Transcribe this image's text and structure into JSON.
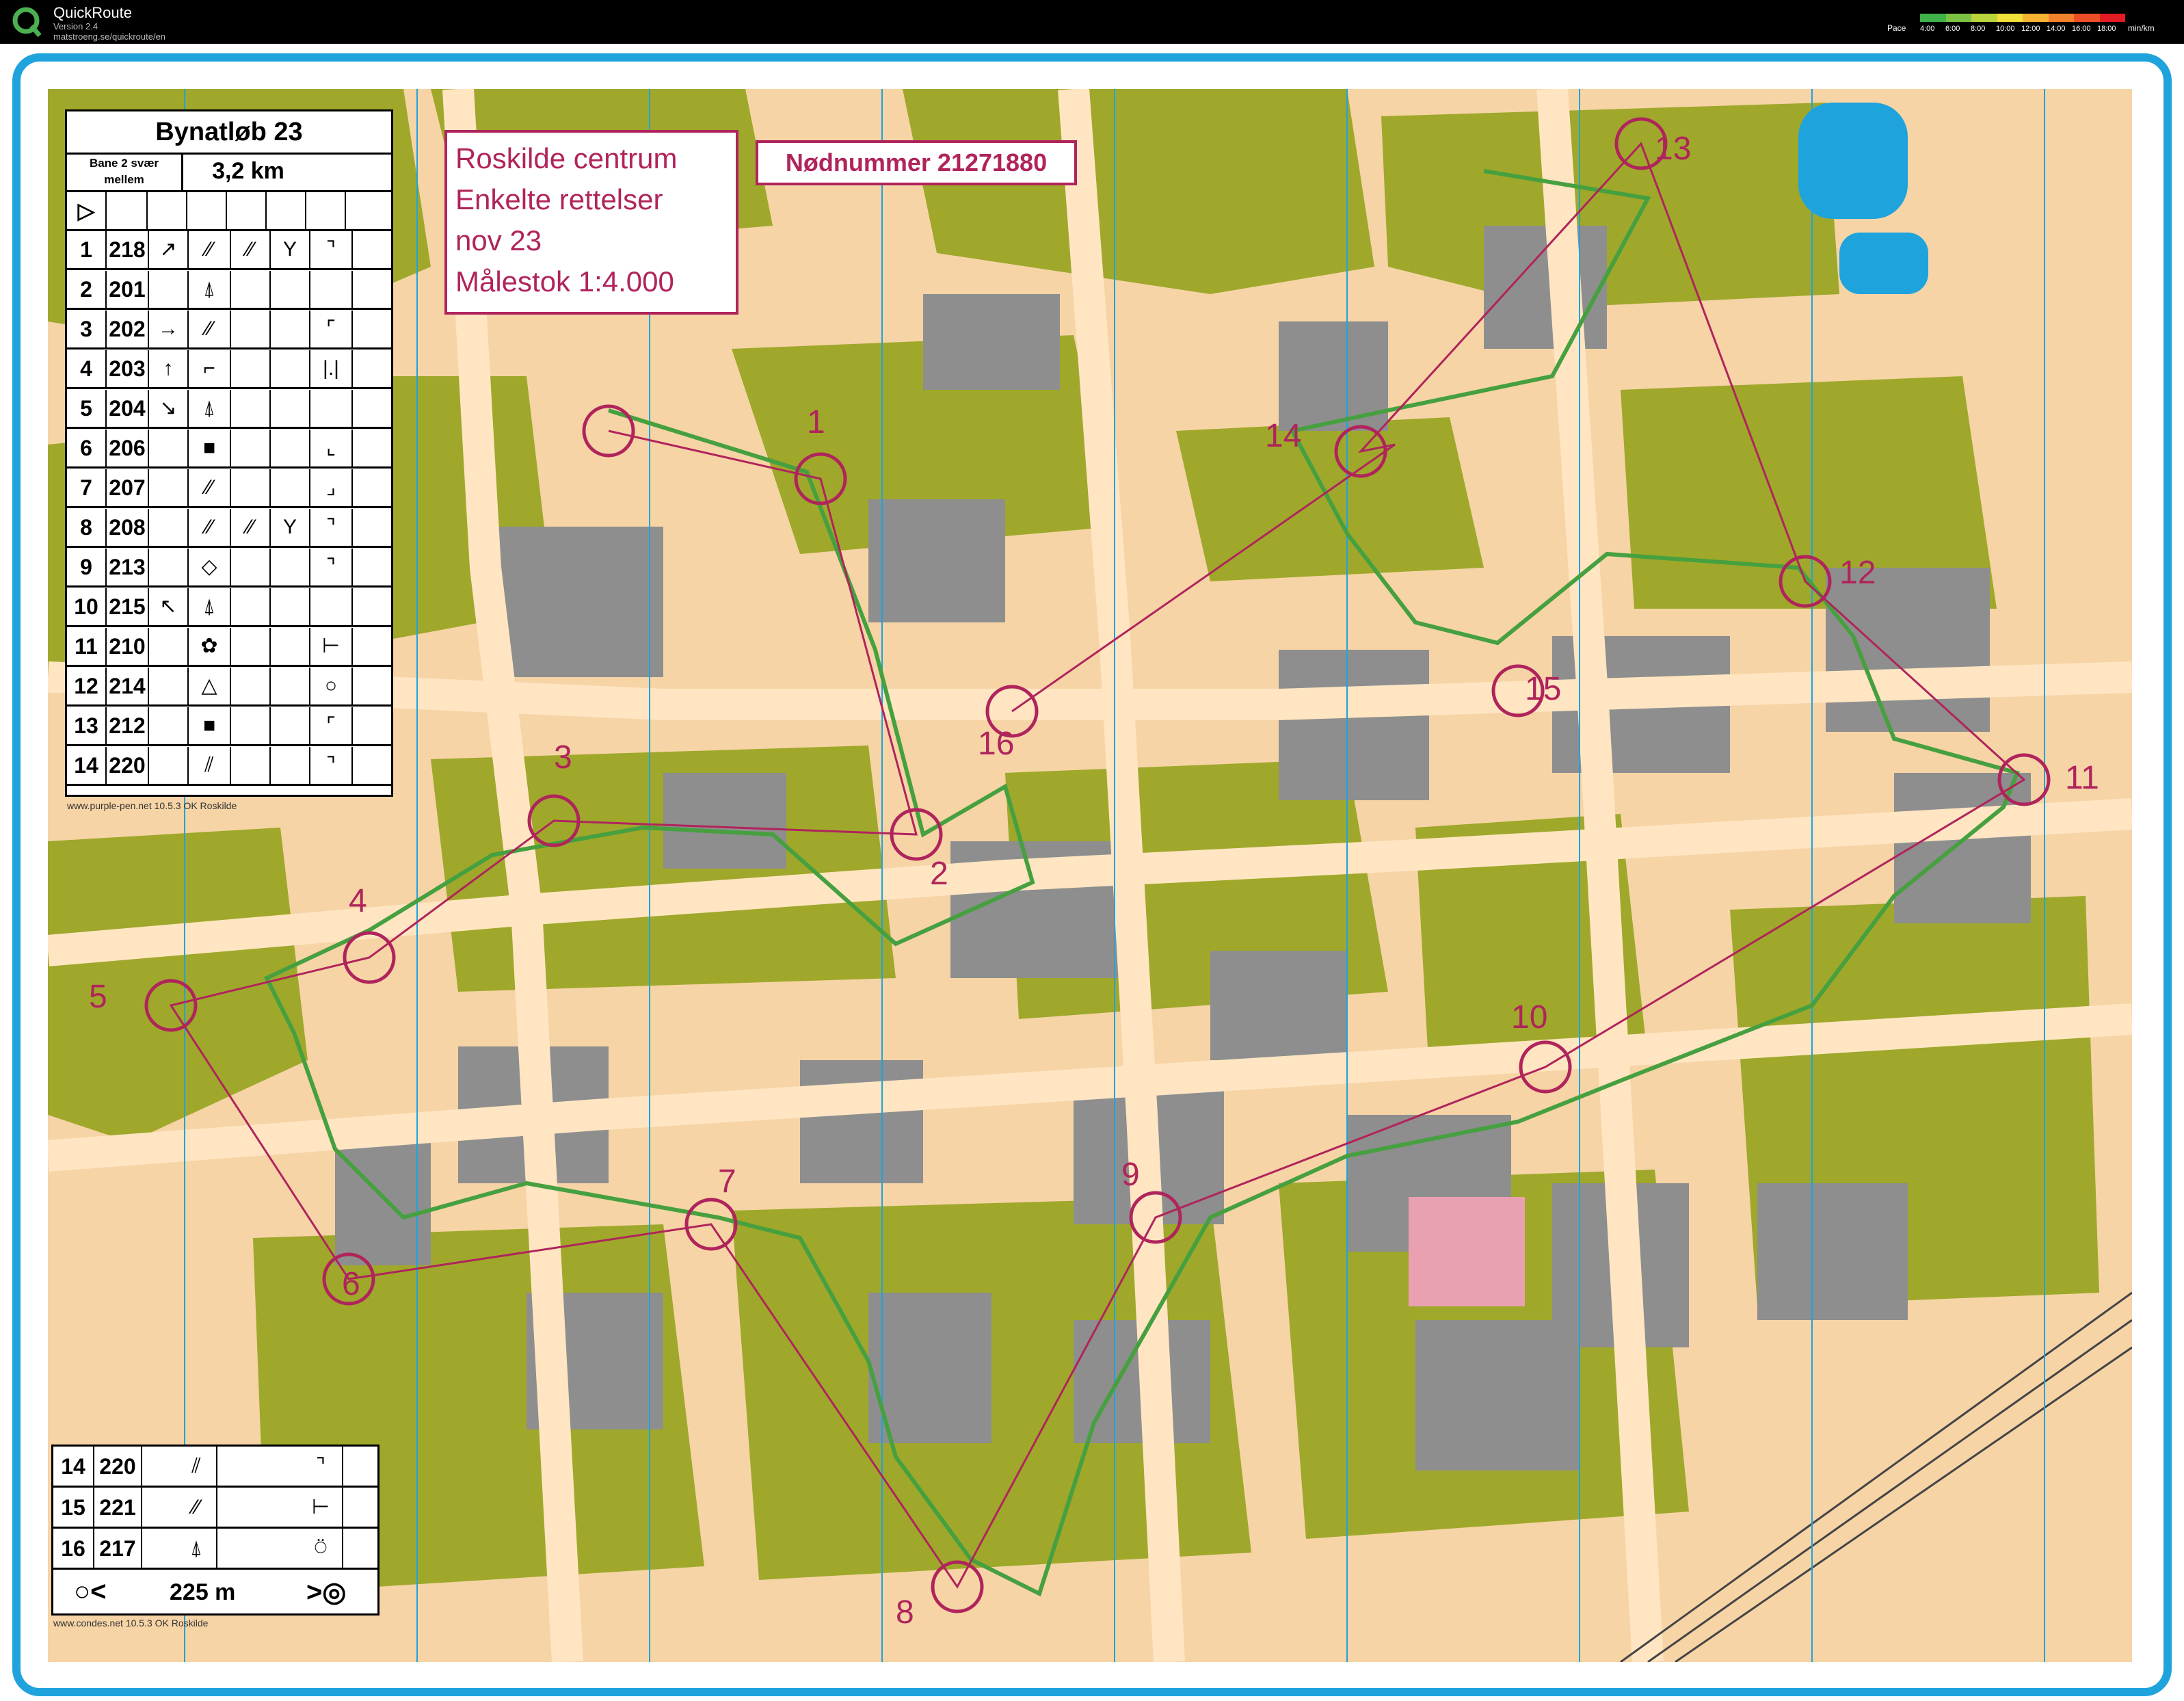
{
  "window": {
    "app_name": "QuickRoute",
    "version": "Version 2.4",
    "url": "matstroeng.se/quickroute/en"
  },
  "pace_scale": {
    "label": "Pace",
    "ticks": [
      "4:00",
      "6:00",
      "8:00",
      "10:00",
      "12:00",
      "14:00",
      "16:00",
      "18:00"
    ],
    "unit": "min/km",
    "colors": [
      "#3fb34a",
      "#7cc344",
      "#b9d43c",
      "#f0e13a",
      "#f7b133",
      "#f3812c",
      "#ec4f28",
      "#e31c23"
    ]
  },
  "colors": {
    "frame": "#1fa3dd",
    "map_open": "#f6d4a6",
    "map_green": "#9fa82a",
    "map_building": "#8e8e8e",
    "map_road": "#ffe5c2",
    "route": "#b0245c",
    "gps_line": "#46a040"
  },
  "info": {
    "lines": [
      "Roskilde centrum",
      "Enkelte rettelser",
      "nov 23",
      "Målestok 1:4.000"
    ],
    "phone": "Nødnummer 21271880"
  },
  "control_description": {
    "title": "Bynatløb 23",
    "course_line1": "Bane 2 svær",
    "course_line2": "mellem",
    "length": "3,2 km",
    "start_symbol": "▷",
    "rows": [
      {
        "num": "1",
        "code": "218",
        "c": "↗",
        "d": "⁄⁄",
        "e": "⁄⁄",
        "f": "Y",
        "g": "⌝"
      },
      {
        "num": "2",
        "code": "201",
        "c": "",
        "d": "⍋",
        "e": "",
        "f": "",
        "g": ""
      },
      {
        "num": "3",
        "code": "202",
        "c": "→",
        "d": "⁄⁄",
        "e": "",
        "f": "",
        "g": "⌜"
      },
      {
        "num": "4",
        "code": "203",
        "c": "↑",
        "d": "⌐",
        "e": "",
        "f": "",
        "g": "|.|"
      },
      {
        "num": "5",
        "code": "204",
        "c": "↘",
        "d": "⍋",
        "e": "",
        "f": "",
        "g": ""
      },
      {
        "num": "6",
        "code": "206",
        "c": "",
        "d": "■",
        "e": "",
        "f": "",
        "g": "⌞"
      },
      {
        "num": "7",
        "code": "207",
        "c": "",
        "d": "⁄⁄",
        "e": "",
        "f": "",
        "g": "⌟"
      },
      {
        "num": "8",
        "code": "208",
        "c": "",
        "d": "⁄⁄",
        "e": "⁄⁄",
        "f": "Y",
        "g": "⌝"
      },
      {
        "num": "9",
        "code": "213",
        "c": "",
        "d": "◇",
        "e": "",
        "f": "",
        "g": "⌝"
      },
      {
        "num": "10",
        "code": "215",
        "c": "↖",
        "d": "⍋",
        "e": "",
        "f": "",
        "g": ""
      },
      {
        "num": "11",
        "code": "210",
        "c": "",
        "d": "✿",
        "e": "",
        "f": "",
        "g": "⊢"
      },
      {
        "num": "12",
        "code": "214",
        "c": "",
        "d": "△",
        "e": "",
        "f": "",
        "g": "○"
      },
      {
        "num": "13",
        "code": "212",
        "c": "",
        "d": "■",
        "e": "",
        "f": "",
        "g": "⌜"
      },
      {
        "num": "14",
        "code": "220",
        "c": "",
        "d": "⫽",
        "e": "",
        "f": "",
        "g": "⌝"
      }
    ],
    "credit": "www.purple-pen.net 10.5.3 OK Roskilde"
  },
  "control_description_footer": {
    "rows": [
      {
        "num": "14",
        "code": "220",
        "d": "⫽",
        "g": "⌝"
      },
      {
        "num": "15",
        "code": "221",
        "d": "⁄⁄",
        "g": "⊢"
      },
      {
        "num": "16",
        "code": "217",
        "d": "⍋",
        "g": "⍥"
      }
    ],
    "finish_left": "○<",
    "finish_distance": "225 m",
    "finish_right": ">◎",
    "credit": "www.condes.net 10.5.3 OK Roskilde"
  },
  "controls": [
    {
      "label": "1"
    },
    {
      "label": "2"
    },
    {
      "label": "3"
    },
    {
      "label": "4"
    },
    {
      "label": "5"
    },
    {
      "label": "6"
    },
    {
      "label": "7"
    },
    {
      "label": "8"
    },
    {
      "label": "9"
    },
    {
      "label": "10"
    },
    {
      "label": "11"
    },
    {
      "label": "12"
    },
    {
      "label": "13"
    },
    {
      "label": "14"
    },
    {
      "label": "15"
    },
    {
      "label": "16"
    }
  ]
}
